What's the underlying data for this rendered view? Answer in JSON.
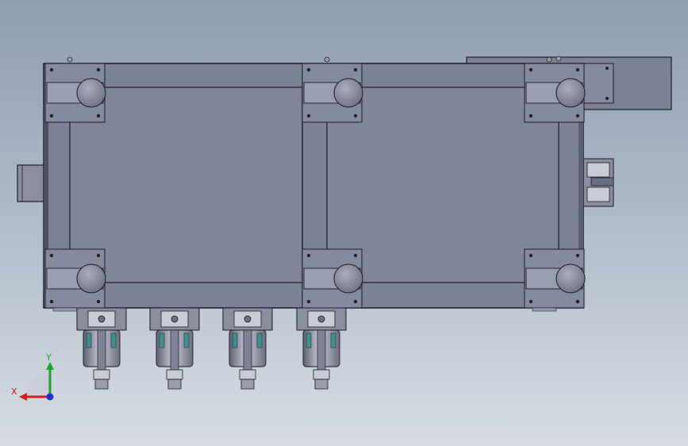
{
  "viewport": {
    "kind": "cad-3d-viewport",
    "view": "top",
    "background_colors": [
      "#8f9db1",
      "#d8dde4"
    ]
  },
  "model": {
    "body_color": "#7c8196",
    "body_dark": "#6b7085",
    "edge_color": "#1c1c24",
    "metal_light": "#c9ccd6",
    "metal_mid": "#9a9dab",
    "accent_teal": "#3f8f8f"
  },
  "triad": {
    "x_label": "X",
    "y_label": "Y",
    "x_color": "#d22020",
    "y_color": "#20a030",
    "z_color": "#2030d0"
  }
}
